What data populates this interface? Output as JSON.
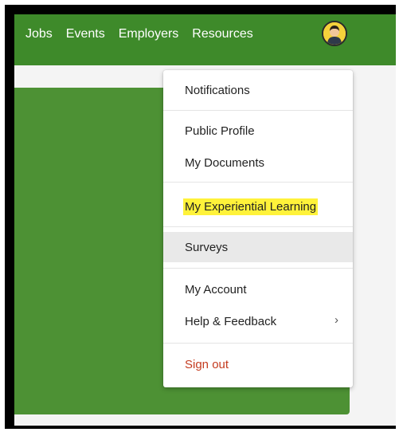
{
  "nav": {
    "links": [
      "Jobs",
      "Events",
      "Employers",
      "Resources"
    ]
  },
  "avatar": {
    "icon": "user-avatar-icon"
  },
  "menu": {
    "items": [
      {
        "label": "Notifications"
      },
      {
        "label": "Public Profile"
      },
      {
        "label": "My Documents"
      },
      {
        "label": "My Experiential Learning",
        "highlighted": true
      },
      {
        "label": "Surveys",
        "active": true
      },
      {
        "label": "My Account"
      },
      {
        "label": "Help & Feedback",
        "has_submenu": true,
        "chevron": "›"
      },
      {
        "label": "Sign out",
        "color": "#c43b1f"
      }
    ]
  },
  "colors": {
    "topbar": "#3e8a2a",
    "hero": "#4d9134",
    "highlight": "#fff23a",
    "signout": "#c43b1f"
  }
}
